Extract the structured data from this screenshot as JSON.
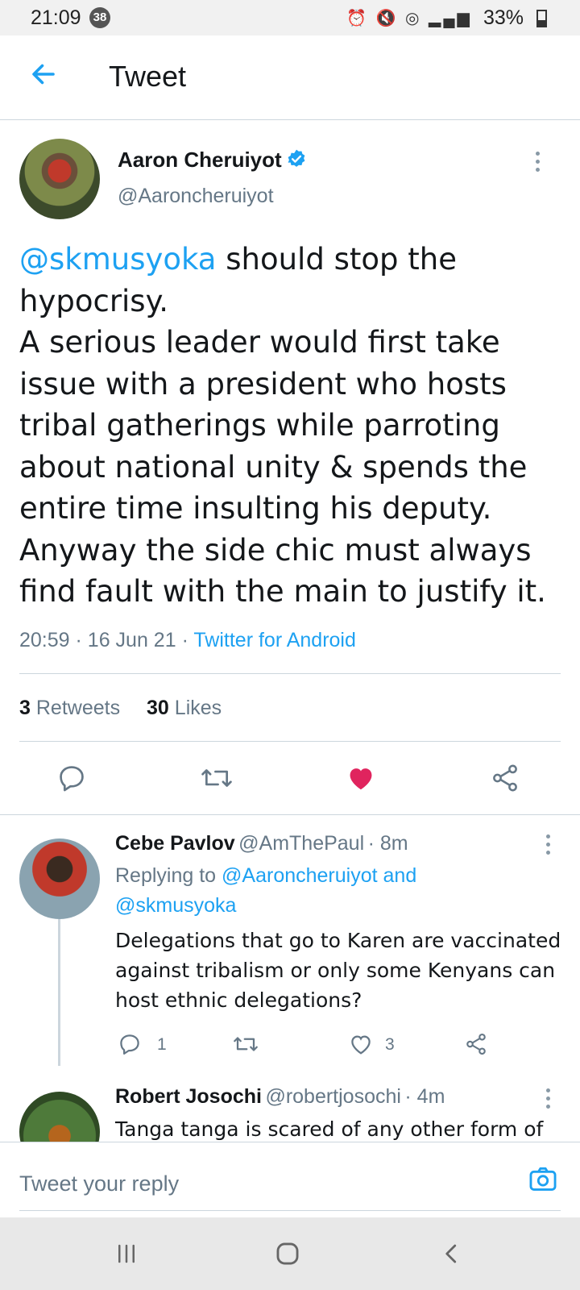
{
  "status_bar": {
    "time": "21:09",
    "notification_count": "38",
    "battery": "33%"
  },
  "app_bar": {
    "title": "Tweet"
  },
  "tweet": {
    "author_name": "Aaron Cheruiyot",
    "author_handle": "@Aaroncheruiyot",
    "mention": "@skmusyoka",
    "text_after_mention": " should stop the hypocrisy.",
    "lines": [
      "A serious leader would first take",
      "issue with a president who hosts",
      "tribal gatherings while parroting",
      "about national unity & spends the",
      "entire time insulting his deputy.",
      "Anyway the side chic must always",
      "find fault with the main to justify it."
    ],
    "time": "20:59",
    "date": "16 Jun 21",
    "source": "Twitter for Android",
    "retweets_count": "3",
    "retweets_label": "Retweets",
    "likes_count": "30",
    "likes_label": "Likes",
    "liked": true,
    "colors": {
      "accent": "#1da1f2",
      "like": "#e0245e"
    }
  },
  "replies": [
    {
      "name": "Cebe Pavlov",
      "handle": "@AmThePaul",
      "age": "· 8m",
      "replying_prefix": "Replying to ",
      "replying_to_1": "@Aaroncheruiyot and",
      "replying_to_2": "@skmusyoka",
      "text_lines": [
        "Delegations that go to Karen are vaccinated",
        "against tribalism or only some Kenyans can",
        "host ethnic delegations?"
      ],
      "reply_count": "1",
      "like_count": "3"
    },
    {
      "name": "Robert Josochi",
      "handle": "@robertjosochi",
      "age": "· 4m",
      "text_partial": "Tanga tanga is scared of any other form of"
    }
  ],
  "composer": {
    "placeholder": "Tweet your reply"
  }
}
